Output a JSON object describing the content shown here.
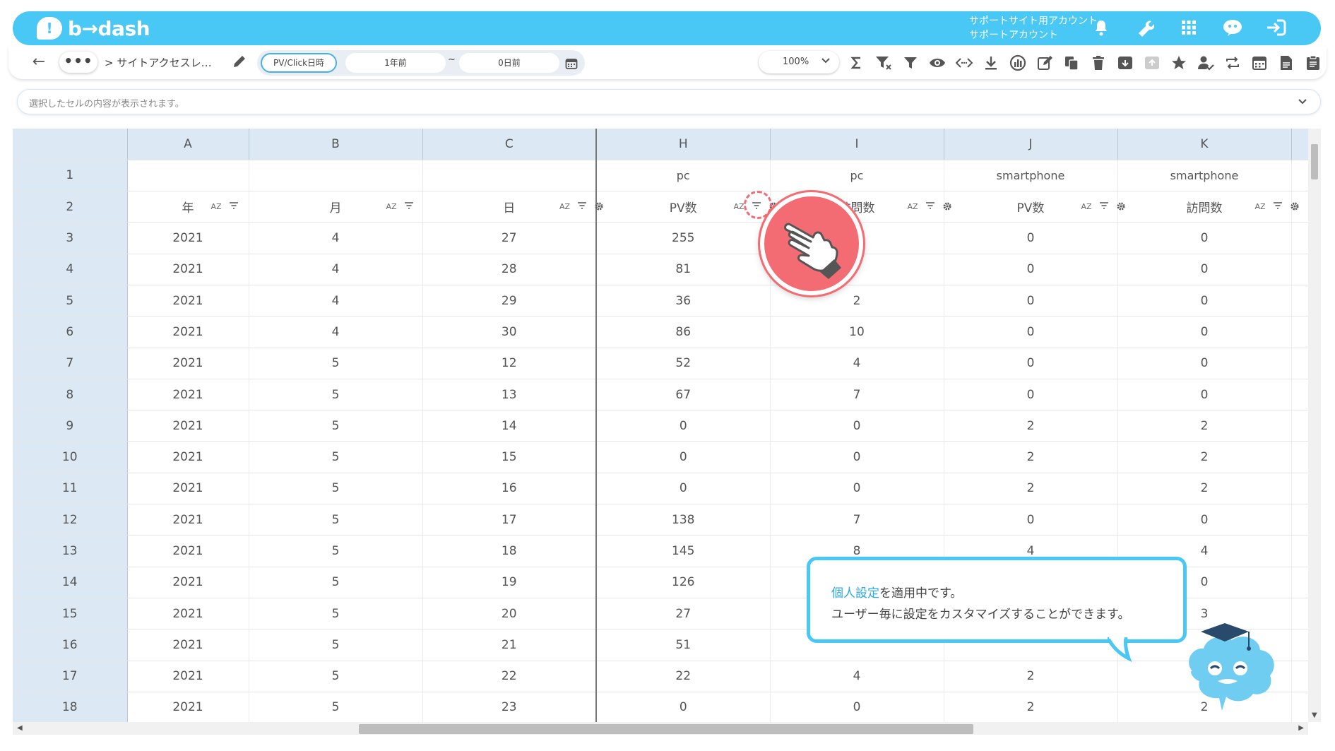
{
  "app": {
    "logo_mark": "!",
    "logo_text": "b→dash",
    "account_line1": "サポートサイト用アカウント",
    "account_line2": "サポートアカウント"
  },
  "header_icons": [
    "bell-icon",
    "wrench-icon",
    "grid-icon",
    "chat-bot-icon",
    "logout-icon"
  ],
  "toolbar": {
    "back": "←",
    "more": "•••",
    "breadcrumb": "> サイトアクセスレ…",
    "date_mode": "PV/Click日時",
    "date_from": "1年前",
    "date_sep": "~",
    "date_to": "0日前",
    "zoom": "100%",
    "icons": [
      "sigma-icon",
      "filter-clear-icon",
      "filter-icon",
      "eye-icon",
      "code-icon",
      "download-icon",
      "chart-icon",
      "edit-icon",
      "copy-icon",
      "trash-icon",
      "archive-icon",
      "unarchive-icon",
      "star-icon",
      "user-check-icon",
      "refresh-icon",
      "calendar-icon",
      "document-icon",
      "clipboard-icon"
    ]
  },
  "cellbar": {
    "placeholder": "選択したセルの内容が表示されます。"
  },
  "sheet": {
    "columns": [
      "A",
      "B",
      "C",
      "H",
      "I",
      "J",
      "K"
    ],
    "row1": [
      "",
      "",
      "",
      "pc",
      "pc",
      "smartphone",
      "smartphone"
    ],
    "row2": [
      "年",
      "月",
      "日",
      "PV数",
      "訪問数",
      "PV数",
      "訪問数"
    ],
    "sort_label": "AZ",
    "rows": [
      {
        "n": "1"
      },
      {
        "n": "2"
      },
      {
        "n": "3",
        "v": [
          "2021",
          "4",
          "27",
          "255",
          "",
          "0",
          "0"
        ]
      },
      {
        "n": "4",
        "v": [
          "2021",
          "4",
          "28",
          "81",
          "",
          "0",
          "0"
        ]
      },
      {
        "n": "5",
        "v": [
          "2021",
          "4",
          "29",
          "36",
          "2",
          "0",
          "0"
        ]
      },
      {
        "n": "6",
        "v": [
          "2021",
          "4",
          "30",
          "86",
          "10",
          "0",
          "0"
        ]
      },
      {
        "n": "7",
        "v": [
          "2021",
          "5",
          "12",
          "52",
          "4",
          "0",
          "0"
        ]
      },
      {
        "n": "8",
        "v": [
          "2021",
          "5",
          "13",
          "67",
          "7",
          "0",
          "0"
        ]
      },
      {
        "n": "9",
        "v": [
          "2021",
          "5",
          "14",
          "0",
          "0",
          "2",
          "2"
        ]
      },
      {
        "n": "10",
        "v": [
          "2021",
          "5",
          "15",
          "0",
          "0",
          "2",
          "2"
        ]
      },
      {
        "n": "11",
        "v": [
          "2021",
          "5",
          "16",
          "0",
          "0",
          "2",
          "2"
        ]
      },
      {
        "n": "12",
        "v": [
          "2021",
          "5",
          "17",
          "138",
          "7",
          "0",
          "0"
        ]
      },
      {
        "n": "13",
        "v": [
          "2021",
          "5",
          "18",
          "145",
          "8",
          "4",
          "4"
        ]
      },
      {
        "n": "14",
        "v": [
          "2021",
          "5",
          "19",
          "126",
          "",
          "",
          "0"
        ]
      },
      {
        "n": "15",
        "v": [
          "2021",
          "5",
          "20",
          "27",
          "",
          "",
          "3"
        ]
      },
      {
        "n": "16",
        "v": [
          "2021",
          "5",
          "21",
          "51",
          "",
          "",
          ""
        ]
      },
      {
        "n": "17",
        "v": [
          "2021",
          "5",
          "22",
          "22",
          "4",
          "2",
          ""
        ]
      },
      {
        "n": "18",
        "v": [
          "2021",
          "5",
          "23",
          "0",
          "0",
          "2",
          "2"
        ]
      }
    ]
  },
  "tooltip": {
    "link": "個人設定",
    "line1_rest": "を適用中です。",
    "line2": "ユーザー毎に設定をカスタマイズすることができます。"
  },
  "colors": {
    "brand": "#49c8f5",
    "pointer": "#f36b73",
    "header_bg": "#dce9f5"
  }
}
